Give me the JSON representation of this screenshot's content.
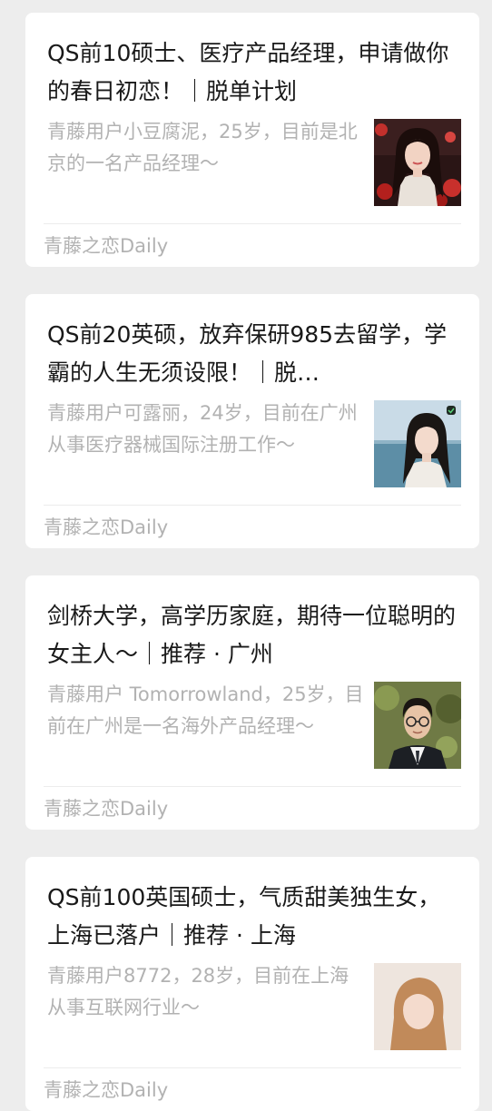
{
  "feed": {
    "articles": [
      {
        "title": "QS前10硕士、医疗产品经理，申请做你的春日初恋！｜脱单计划",
        "excerpt": "青藤用户小豆腐泥，25岁，目前是北京的一名产品经理～",
        "source": "青藤之恋Daily",
        "thumbnail_icon": "woman-portrait-red-flowers"
      },
      {
        "title": "QS前20英硕，放弃保研985去留学，学霸的人生无须设限！｜脱…",
        "excerpt": "青藤用户可露丽，24岁，目前在广州从事医疗器械国际注册工作～",
        "source": "青藤之恋Daily",
        "thumbnail_icon": "woman-portrait-seaside"
      },
      {
        "title": "剑桥大学，高学历家庭，期待一位聪明的女主人～｜推荐 · 广州",
        "excerpt": "青藤用户 Tomorrowland，25岁，目前在广州是一名海外产品经理～",
        "source": "青藤之恋Daily",
        "thumbnail_icon": "man-portrait-glasses-suit"
      },
      {
        "title": "QS前100英国硕士，气质甜美独生女，上海已落户｜推荐 · 上海",
        "excerpt": "青藤用户8772，28岁，目前在上海从事互联网行业～",
        "source": "青藤之恋Daily",
        "thumbnail_icon": "woman-portrait"
      }
    ]
  }
}
